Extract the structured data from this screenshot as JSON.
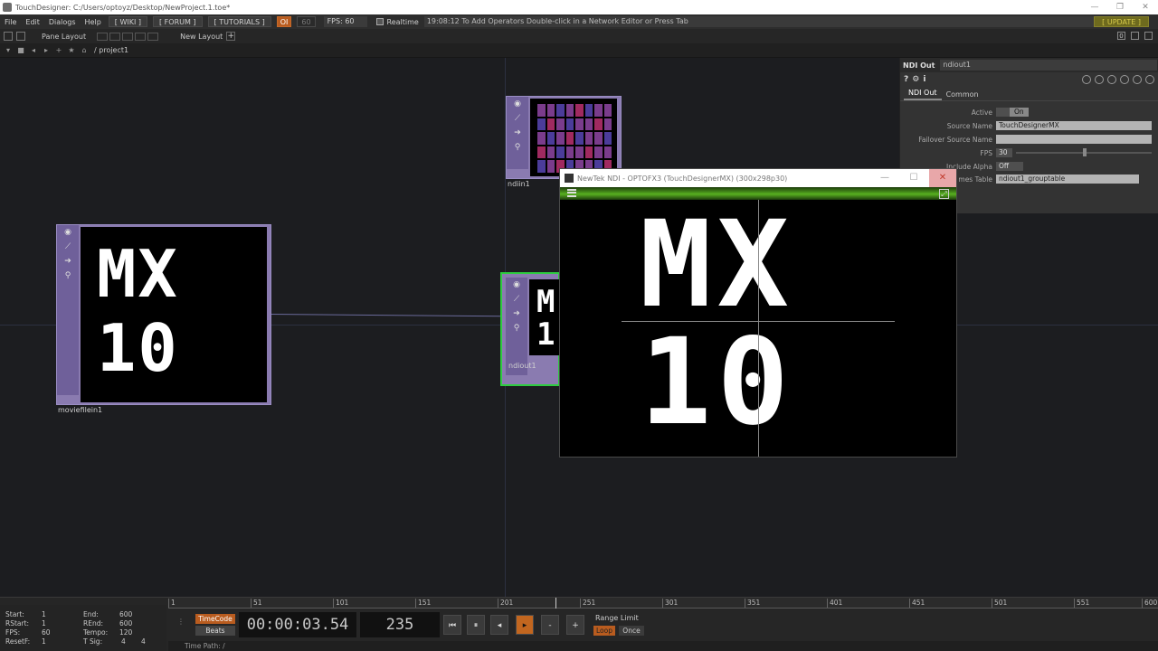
{
  "window": {
    "title": "TouchDesigner: C:/Users/optoyz/Desktop/NewProject.1.toe*"
  },
  "menubar": {
    "items": [
      "File",
      "Edit",
      "Dialogs",
      "Help"
    ],
    "wiki": "[ WIKI ]",
    "forum": "[ FORUM ]",
    "tutorials": "[ TUTORIALS ]",
    "oi": "OI",
    "sixty": "60",
    "fps_label": "FPS:",
    "fps_value": "60",
    "realtime": "Realtime",
    "status": "19:08:12 To Add Operators Double-click in a Network Editor or Press Tab",
    "update": "[ UPDATE ]"
  },
  "panebar": {
    "pane_layout": "Pane Layout",
    "new_layout": "New Layout",
    "plus": "+",
    "right_icon": "0"
  },
  "pathbar": {
    "path": "/ project1"
  },
  "nodes": {
    "moviefilein": {
      "name": "moviefilein1",
      "line1": "MX",
      "line2": "10"
    },
    "ndiin": {
      "name": "ndiin1"
    },
    "ndiout": {
      "name": "ndiout1",
      "line1": "M",
      "line2": "1("
    }
  },
  "params": {
    "op_type": "NDI Out",
    "op_name": "ndiout1",
    "tools": {
      "help": "?",
      "info": "i"
    },
    "tabs": [
      "NDI Out",
      "Common"
    ],
    "active": {
      "label": "Active",
      "value": "On"
    },
    "source_name": {
      "label": "Source Name",
      "value": "TouchDesignerMX"
    },
    "failover": {
      "label": "Failover Source Name",
      "value": ""
    },
    "fps": {
      "label": "FPS",
      "value": "30"
    },
    "include_alpha": {
      "label": "Include Alpha",
      "value": "Off"
    },
    "groups_table": {
      "label": "mes Table",
      "value": "ndiout1_grouptable"
    }
  },
  "ndi_window": {
    "title": "NewTek NDI - OPTOFX3 (TouchDesignerMX) (300x298p30)",
    "line1": "MX",
    "line2": "10",
    "min": "—",
    "max": "☐",
    "close": "✕"
  },
  "timeline": {
    "info": {
      "start_label": "Start:",
      "start": "1",
      "end_label": "End:",
      "end": "600",
      "rstart_label": "RStart:",
      "rstart": "1",
      "rend_label": "REnd:",
      "rend": "600",
      "fps_label": "FPS:",
      "fps": "60",
      "tempo_label": "Tempo:",
      "tempo": "120",
      "resetf_label": "ResetF:",
      "resetf": "1",
      "tsig_label": "T Sig:",
      "tsig_a": "4",
      "tsig_b": "4"
    },
    "ruler": [
      "1",
      "51",
      "101",
      "151",
      "201",
      "251",
      "301",
      "351",
      "401",
      "451",
      "501",
      "551",
      "600"
    ],
    "timecode": "TimeCode",
    "beats": "Beats",
    "time": "00:00:03.54",
    "frame": "235",
    "buttons": [
      "⏮",
      "⏸",
      "◂",
      "▸",
      "-",
      "+"
    ],
    "range_limit": "Range Limit",
    "loop": "Loop",
    "once": "Once",
    "time_path": "Time Path: /"
  }
}
